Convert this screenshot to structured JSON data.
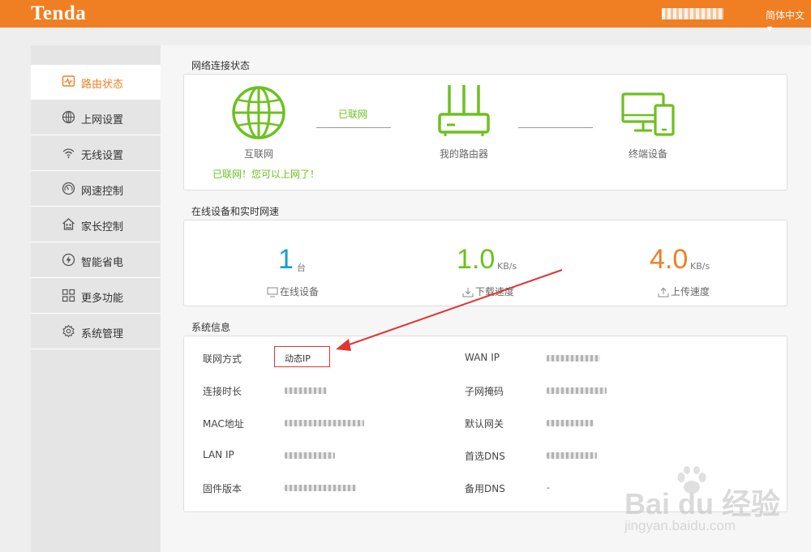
{
  "header": {
    "logo": "Tenda",
    "language": "简体中文",
    "colors": {
      "brand": "#f07e22"
    }
  },
  "sidebar": {
    "items": [
      {
        "label": "路由状态",
        "icon": "status-monitor-icon",
        "active": true
      },
      {
        "label": "上网设置",
        "icon": "globe-icon"
      },
      {
        "label": "无线设置",
        "icon": "wifi-icon"
      },
      {
        "label": "网速控制",
        "icon": "speedometer-icon"
      },
      {
        "label": "家长控制",
        "icon": "home-parental-icon"
      },
      {
        "label": "智能省电",
        "icon": "power-saving-icon"
      },
      {
        "label": "更多功能",
        "icon": "grid-icon"
      },
      {
        "label": "系统管理",
        "icon": "gear-icon"
      }
    ]
  },
  "network": {
    "title": "网络连接状态",
    "internet_label": "互联网",
    "link_status": "已联网",
    "internet_status": "已联网！您可以上网了！",
    "router_label": "我的路由器",
    "devices_label": "终端设备"
  },
  "realtime": {
    "title": "在线设备和实时网速",
    "devices": {
      "value": "1",
      "unit": "台",
      "label": "在线设备",
      "color": "#1a9bd7"
    },
    "download": {
      "value": "1.0",
      "unit": "KB/s",
      "label": "下载速度",
      "color": "#6cc11f"
    },
    "upload": {
      "value": "4.0",
      "unit": "KB/s",
      "label": "上传速度",
      "color": "#f07e22"
    }
  },
  "sysinfo": {
    "title": "系统信息",
    "left": [
      {
        "label": "联网方式",
        "value": "动态IP"
      },
      {
        "label": "连接时长",
        "value": ""
      },
      {
        "label": "MAC地址",
        "value": ""
      },
      {
        "label": "LAN IP",
        "value": ""
      },
      {
        "label": "固件版本",
        "value": ""
      }
    ],
    "right": [
      {
        "label": "WAN IP",
        "value": ""
      },
      {
        "label": "子网掩码",
        "value": ""
      },
      {
        "label": "默认网关",
        "value": ""
      },
      {
        "label": "首选DNS",
        "value": ""
      },
      {
        "label": "备用DNS",
        "value": "-"
      }
    ]
  },
  "watermark": {
    "brand": "Bai du 经验",
    "url": "jingyan.baidu.com"
  }
}
